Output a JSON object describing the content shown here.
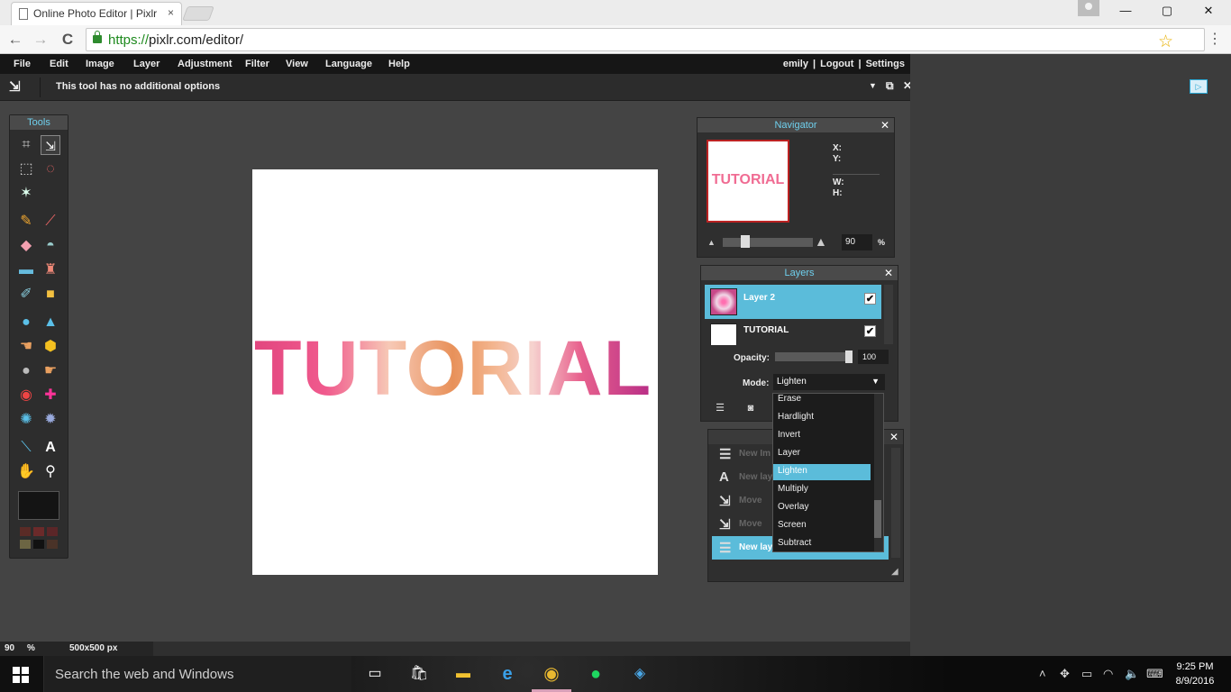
{
  "browser": {
    "tab_title": "Online Photo Editor | Pixlr",
    "tab_close": "×",
    "url_scheme": "https://",
    "url_rest": "pixlr.com/editor/",
    "back": "←",
    "forward": "→",
    "reload": "C",
    "star": "☆",
    "menu": "⋮",
    "minimize": "—",
    "maximize": "▢",
    "close": "✕"
  },
  "menu": [
    "File",
    "Edit",
    "Image",
    "Layer",
    "Adjustment",
    "Filter",
    "View",
    "Language",
    "Help"
  ],
  "user_links": "emily  |  Logout  |  Settings",
  "options": {
    "text": "This tool has no additional options"
  },
  "tools": {
    "title": "Tools"
  },
  "canvas": {
    "text": "TUTORIAL"
  },
  "navigator": {
    "title": "Navigator",
    "thumb_text": "TUTORIAL",
    "x_label": "X:",
    "y_label": "Y:",
    "w_label": "W:",
    "h_label": "H:",
    "zoom": "90",
    "percent": "%",
    "zoom_level": 0.25
  },
  "layers": {
    "title": "Layers",
    "items": [
      {
        "name": "Layer 2",
        "visible": "✔"
      },
      {
        "name": "TUTORIAL",
        "visible": "✔"
      }
    ],
    "opacity_label": "Opacity:",
    "opacity": "100",
    "mode_label": "Mode:",
    "mode": "Lighten"
  },
  "blend_modes": [
    "Erase",
    "Hardlight",
    "Invert",
    "Layer",
    "Lighten",
    "Multiply",
    "Overlay",
    "Screen",
    "Subtract"
  ],
  "history": {
    "items": [
      {
        "label": "New Im"
      },
      {
        "label": "New lay"
      },
      {
        "label": "Move"
      },
      {
        "label": "Move"
      },
      {
        "label": "New lay"
      }
    ]
  },
  "status": {
    "zoom": "90",
    "percent": "%",
    "size": "500x500 px"
  },
  "taskbar": {
    "search": "Search the web and Windows",
    "time": "9:25 PM",
    "date": "8/9/2016"
  },
  "colors": {
    "accent": "#5bbcda",
    "panel_title": "#6fd0ee"
  }
}
